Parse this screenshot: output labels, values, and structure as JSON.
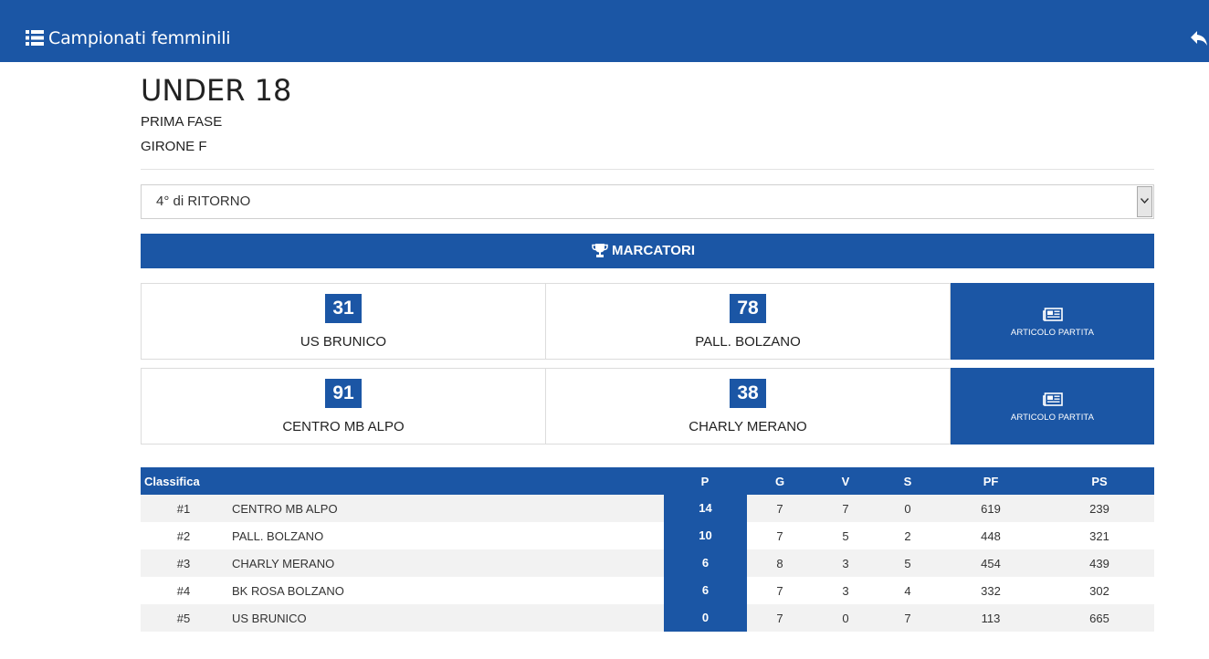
{
  "header": {
    "title": "Campionati femminili",
    "menu_icon": "list-icon",
    "back_icon": "reply-icon"
  },
  "championship": {
    "title": "UNDER 18",
    "phase": "PRIMA FASE",
    "group": "GIRONE F"
  },
  "round_select": {
    "value": "4° di RITORNO"
  },
  "scorers_button": {
    "label": "MARCATORI",
    "icon": "trophy-icon"
  },
  "matches": [
    {
      "home_team": "US BRUNICO",
      "home_score": "31",
      "away_team": "PALL. BOLZANO",
      "away_score": "78",
      "article_label": "ARTICOLO PARTITA"
    },
    {
      "home_team": "CENTRO MB ALPO",
      "home_score": "91",
      "away_team": "CHARLY MERANO",
      "away_score": "38",
      "article_label": "ARTICOLO PARTITA"
    }
  ],
  "standings": {
    "headers": {
      "label": "Classifica",
      "p": "P",
      "g": "G",
      "v": "V",
      "s": "S",
      "pf": "PF",
      "ps": "PS"
    },
    "rows": [
      {
        "rank": "#1",
        "team": "CENTRO MB ALPO",
        "p": "14",
        "g": "7",
        "v": "7",
        "s": "0",
        "pf": "619",
        "ps": "239"
      },
      {
        "rank": "#2",
        "team": "PALL. BOLZANO",
        "p": "10",
        "g": "7",
        "v": "5",
        "s": "2",
        "pf": "448",
        "ps": "321"
      },
      {
        "rank": "#3",
        "team": "CHARLY MERANO",
        "p": "6",
        "g": "8",
        "v": "3",
        "s": "5",
        "pf": "454",
        "ps": "439"
      },
      {
        "rank": "#4",
        "team": "BK ROSA BOLZANO",
        "p": "6",
        "g": "7",
        "v": "3",
        "s": "4",
        "pf": "332",
        "ps": "302"
      },
      {
        "rank": "#5",
        "team": "US BRUNICO",
        "p": "0",
        "g": "7",
        "v": "0",
        "s": "7",
        "pf": "113",
        "ps": "665"
      }
    ]
  },
  "colors": {
    "primary": "#1b56a5",
    "row_alt": "#f2f2f2"
  }
}
